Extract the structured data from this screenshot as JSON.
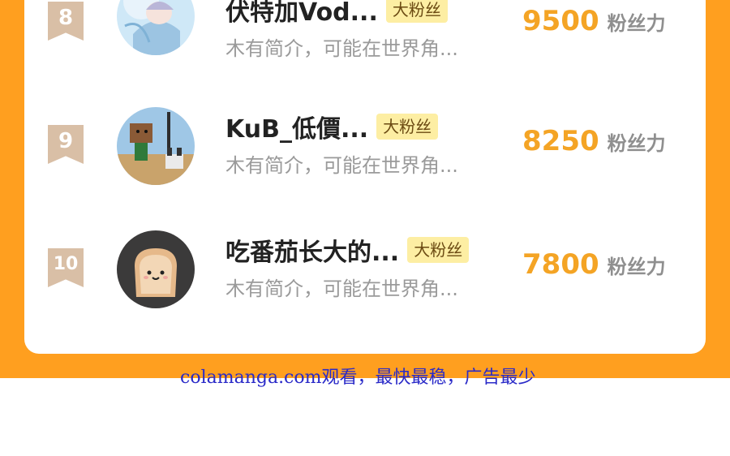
{
  "leaderboard": {
    "rows": [
      {
        "rank": "8",
        "name": "伏特加Vod...",
        "badge": "大粉丝",
        "bio": "木有简介，可能在世界角...",
        "score": "9500",
        "score_unit": "粉丝力",
        "avatar": "anime-character-avatar"
      },
      {
        "rank": "9",
        "name": "KuB_低價...",
        "badge": "大粉丝",
        "bio": "木有简介，可能在世界角...",
        "score": "8250",
        "score_unit": "粉丝力",
        "avatar": "game-characters-avatar"
      },
      {
        "rank": "10",
        "name": "吃番茄长大的...",
        "badge": "大粉丝",
        "bio": "木有简介，可能在世界角...",
        "score": "7800",
        "score_unit": "粉丝力",
        "avatar": "toast-plush-avatar"
      }
    ]
  },
  "watermark": "colamanga.com观看，最快最稳，广告最少",
  "colors": {
    "accent_orange": "#ff9f1f",
    "score_color": "#f4a425",
    "badge_bg": "#fdeea3",
    "rank_ribbon": "#d9bfa6"
  }
}
